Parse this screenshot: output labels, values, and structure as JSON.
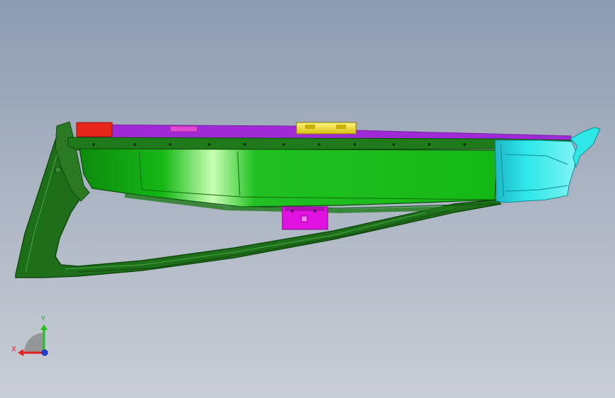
{
  "viewport": {
    "background_top": "#8e9cb0",
    "background_bottom": "#c9ced6"
  },
  "model": {
    "colors": {
      "frame": "#1f6e1a",
      "frame_dark": "#0f4a0c",
      "panel": "#14b814",
      "panel_highlight": "#c8ffb4",
      "top_plate": "#a02bd6",
      "top_plate_edge": "#7a1fa6",
      "red_block": "#e8261c",
      "yellow_clip": "#f0e024",
      "pink_tab": "#e04ad0",
      "magenta_bracket": "#e012e0",
      "cyan_end": "#2ee8e8"
    }
  },
  "triad": {
    "x_label": "X",
    "y_label": "Y",
    "x_color": "#e02020",
    "y_color": "#20c020",
    "z_color": "#2040e0",
    "x_label_color": "#e02020",
    "y_label_color": "#20b020"
  }
}
